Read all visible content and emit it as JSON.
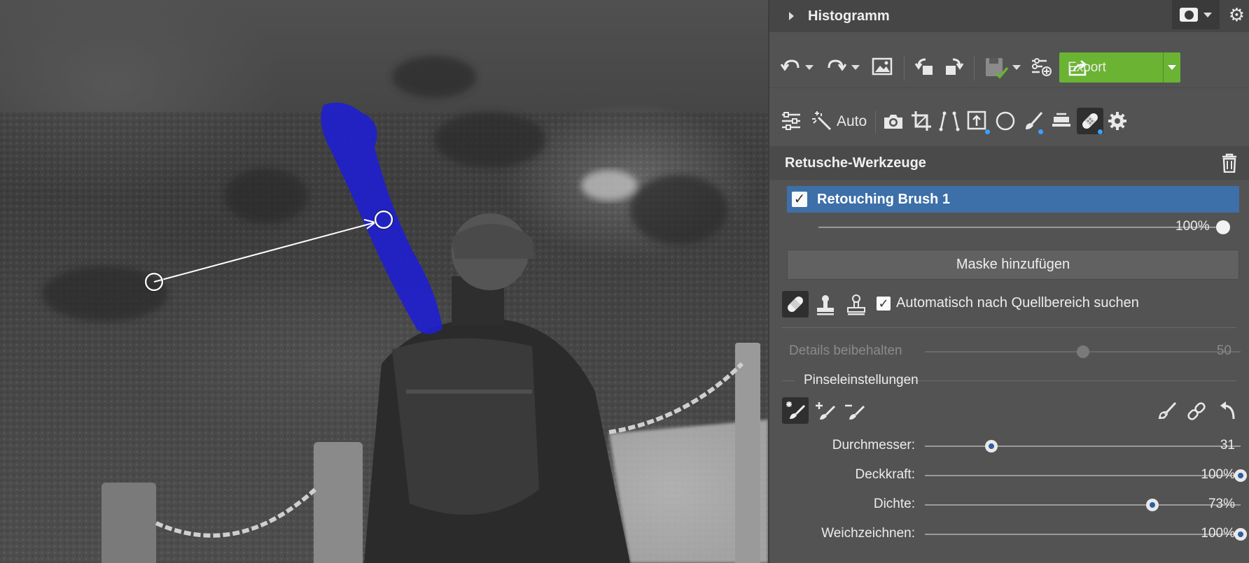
{
  "histogram": {
    "title": "Histogramm"
  },
  "toolbar": {
    "export_label": "Export",
    "auto_label": "Auto"
  },
  "section": {
    "title": "Retusche-Werkzeuge"
  },
  "layer": {
    "name": "Retouching Brush 1",
    "opacity_value": "100%",
    "opacity_level": 1.0
  },
  "mask": {
    "add_label": "Maske hinzufügen"
  },
  "auto_search": {
    "label": "Automatisch nach Quellbereich suchen",
    "checked": true
  },
  "details": {
    "label": "Details beibehalten",
    "value": "50",
    "level": 0.5,
    "enabled": false
  },
  "brush_settings": {
    "title": "Pinseleinstellungen",
    "sliders": [
      {
        "label": "Durchmesser:",
        "value": "31",
        "level": 0.21
      },
      {
        "label": "Deckkraft:",
        "value": "100%",
        "level": 1.0
      },
      {
        "label": "Dichte:",
        "value": "73%",
        "level": 0.72
      },
      {
        "label": "Weichzeichnen:",
        "value": "100%",
        "level": 1.0
      }
    ]
  },
  "colors": {
    "export_green": "#6ab333",
    "selected_layer_blue": "#3d6fa8",
    "brush_stroke": "#1f1fd0",
    "panel_bg": "#535353"
  }
}
